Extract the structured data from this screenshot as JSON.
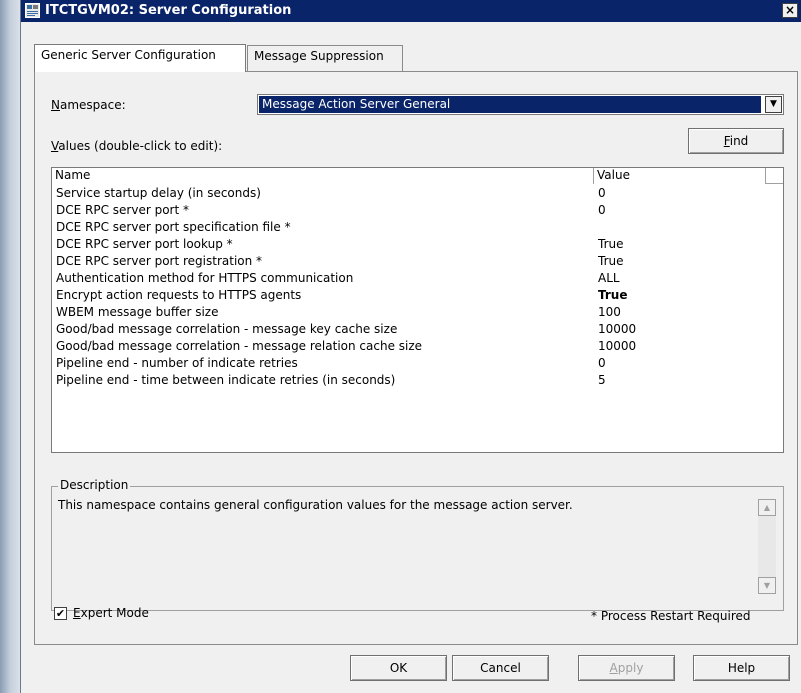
{
  "window": {
    "title": "ITCTGVM02: Server Configuration",
    "close_glyph": "×"
  },
  "tabs": [
    {
      "label": "Generic Server Configuration",
      "active": true
    },
    {
      "label": "Message Suppression",
      "active": false
    }
  ],
  "namespace": {
    "label_prefix": "",
    "label_accel": "N",
    "label_rest": "amespace:",
    "selected": "Message Action Server General"
  },
  "values_label": {
    "accel": "V",
    "rest": "alues (double-click to edit):"
  },
  "find_button": {
    "accel": "F",
    "rest": "ind"
  },
  "table": {
    "headers": [
      "Name",
      "Value"
    ],
    "rows": [
      {
        "name": "Service startup delay (in seconds)",
        "value": "0",
        "bold": false
      },
      {
        "name": "DCE RPC server port *",
        "value": "0",
        "bold": false
      },
      {
        "name": "DCE RPC server port specification file *",
        "value": "",
        "bold": false
      },
      {
        "name": "DCE RPC server port lookup *",
        "value": "True",
        "bold": false
      },
      {
        "name": "DCE RPC server port registration *",
        "value": "True",
        "bold": false
      },
      {
        "name": "Authentication method for HTTPS communication",
        "value": "ALL",
        "bold": false
      },
      {
        "name": "Encrypt action requests to HTTPS agents",
        "value": "True",
        "bold": true
      },
      {
        "name": "WBEM message buffer size",
        "value": "100",
        "bold": false
      },
      {
        "name": "Good/bad message correlation - message key cache size",
        "value": "10000",
        "bold": false
      },
      {
        "name": "Good/bad message correlation - message relation cache size",
        "value": "10000",
        "bold": false
      },
      {
        "name": "Pipeline end - number of indicate retries",
        "value": "0",
        "bold": false
      },
      {
        "name": "Pipeline end - time between indicate retries (in seconds)",
        "value": "5",
        "bold": false
      }
    ]
  },
  "description": {
    "title": "Description",
    "text": "This namespace contains general configuration values for the message action server."
  },
  "expert_mode": {
    "checked": true,
    "check_glyph": "✔",
    "accel": "E",
    "rest": "xpert Mode"
  },
  "restart_note": "* Process Restart Required",
  "buttons": {
    "ok": "OK",
    "cancel": "Cancel",
    "apply_accel": "A",
    "apply_rest": "pply",
    "help": "Help"
  }
}
